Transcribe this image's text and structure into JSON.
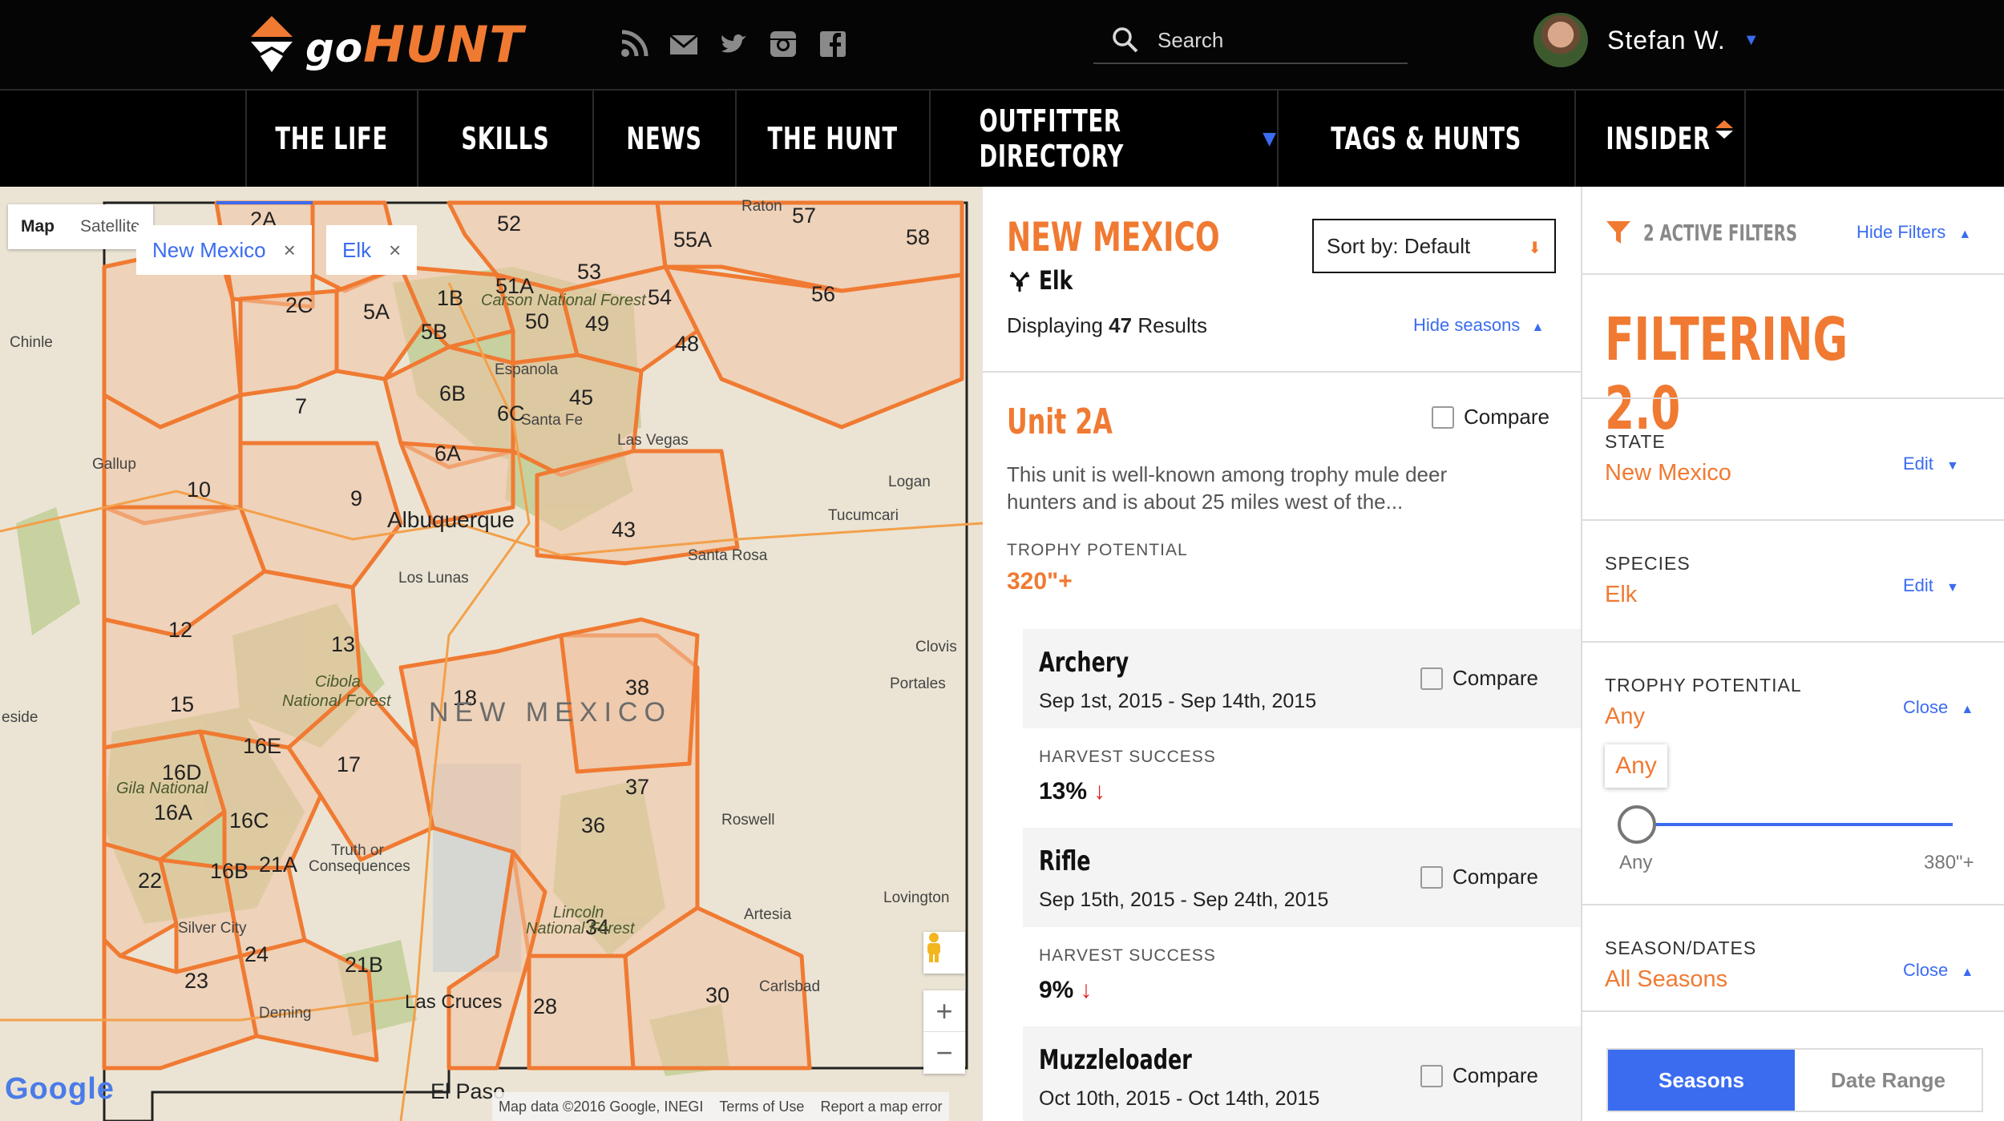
{
  "brand": {
    "go": "go",
    "hunt": "HUNT"
  },
  "colors": {
    "accent": "#f07a32",
    "link": "#3b6cf0",
    "header_bg": "#050505",
    "loss": "#e02424"
  },
  "header": {
    "social_icons": [
      "rss-icon",
      "mail-icon",
      "twitter-icon",
      "instagram-icon",
      "facebook-icon"
    ],
    "search_label": "Search",
    "user_name": "Stefan W."
  },
  "nav": {
    "items": [
      "THE LIFE",
      "SKILLS",
      "NEWS",
      "THE HUNT",
      "OUTFITTER DIRECTORY",
      "TAGS & HUNTS",
      "INSIDER"
    ]
  },
  "map": {
    "map_type": {
      "map": "Map",
      "satellite": "Satellite"
    },
    "chips": [
      {
        "label": "New Mexico"
      },
      {
        "label": "Elk"
      }
    ],
    "chip_close": "×",
    "zoom_in": "+",
    "zoom_out": "−",
    "google": "Google",
    "attribution": {
      "data": "Map data ©2016 Google, INEGI",
      "terms": "Terms of Use",
      "report": "Report a map error"
    },
    "state_label": "NEW MEXICO",
    "units": [
      "2A",
      "52",
      "57",
      "58",
      "55A",
      "53",
      "51A",
      "5B",
      "5A",
      "2C",
      "1B",
      "50",
      "54",
      "49",
      "48",
      "56",
      "7",
      "6B",
      "6C",
      "45",
      "6A",
      "9",
      "10",
      "43",
      "12",
      "13",
      "18",
      "38",
      "15",
      "16E",
      "16D",
      "17",
      "16A",
      "16C",
      "37",
      "36",
      "22",
      "16B",
      "21A",
      "34",
      "24",
      "21B",
      "23",
      "28",
      "30"
    ],
    "places": [
      "Raton",
      "Chinle",
      "Gallup",
      "Albuquerque",
      "Espanola",
      "Santa Fe",
      "Las Vegas",
      "Logan",
      "Tucumcari",
      "Santa Rosa",
      "Los Lunas",
      "Clovis",
      "Portales",
      "Roswell",
      "Truth or Consequences",
      "Silver City",
      "Artesia",
      "Lovington",
      "Las Cruces",
      "Deming",
      "Carlsbad",
      "El Paso",
      "Cibola National Forest",
      "Lincoln National Forest",
      "Gila National",
      "Carson National Forest",
      "eside"
    ]
  },
  "results": {
    "state": "NEW MEXICO",
    "species": "Elk",
    "displaying_prefix": "Displaying ",
    "count": "47",
    "displaying_suffix": " Results",
    "sort_label": "Sort by: Default",
    "hide_seasons": "Hide seasons",
    "unit": {
      "title": "Unit 2A",
      "compare": "Compare",
      "description": "This unit is well-known among trophy mule deer hunters and is about 25 miles west of the...",
      "trophy_label": "TROPHY POTENTIAL",
      "trophy_value": "320\"+"
    },
    "seasons": [
      {
        "name": "Archery",
        "dates": "Sep 1st, 2015 - Sep 14th, 2015",
        "compare": "Compare",
        "harvest_label": "HARVEST SUCCESS",
        "harvest": "13%"
      },
      {
        "name": "Rifle",
        "dates": "Sep 15th, 2015 - Sep 24th, 2015",
        "compare": "Compare",
        "harvest_label": "HARVEST SUCCESS",
        "harvest": "9%"
      },
      {
        "name": "Muzzleloader",
        "dates": "Oct 10th, 2015 - Oct 14th, 2015",
        "compare": "Compare"
      }
    ]
  },
  "filters": {
    "active": "2 ACTIVE FILTERS",
    "hide": "Hide Filters",
    "title": "FILTERING 2.0",
    "sections": [
      {
        "label": "STATE",
        "value": "New Mexico",
        "action": "Edit"
      },
      {
        "label": "SPECIES",
        "value": "Elk",
        "action": "Edit"
      },
      {
        "label": "TROPHY POTENTIAL",
        "value": "Any",
        "action": "Close"
      },
      {
        "label": "SEASON/DATES",
        "value": "All Seasons",
        "action": "Close"
      }
    ],
    "slider": {
      "tooltip": "Any",
      "min_label": "Any",
      "max_label": "380\"+",
      "value_fraction": 0
    },
    "tabs": {
      "seasons": "Seasons",
      "date_range": "Date Range"
    }
  }
}
